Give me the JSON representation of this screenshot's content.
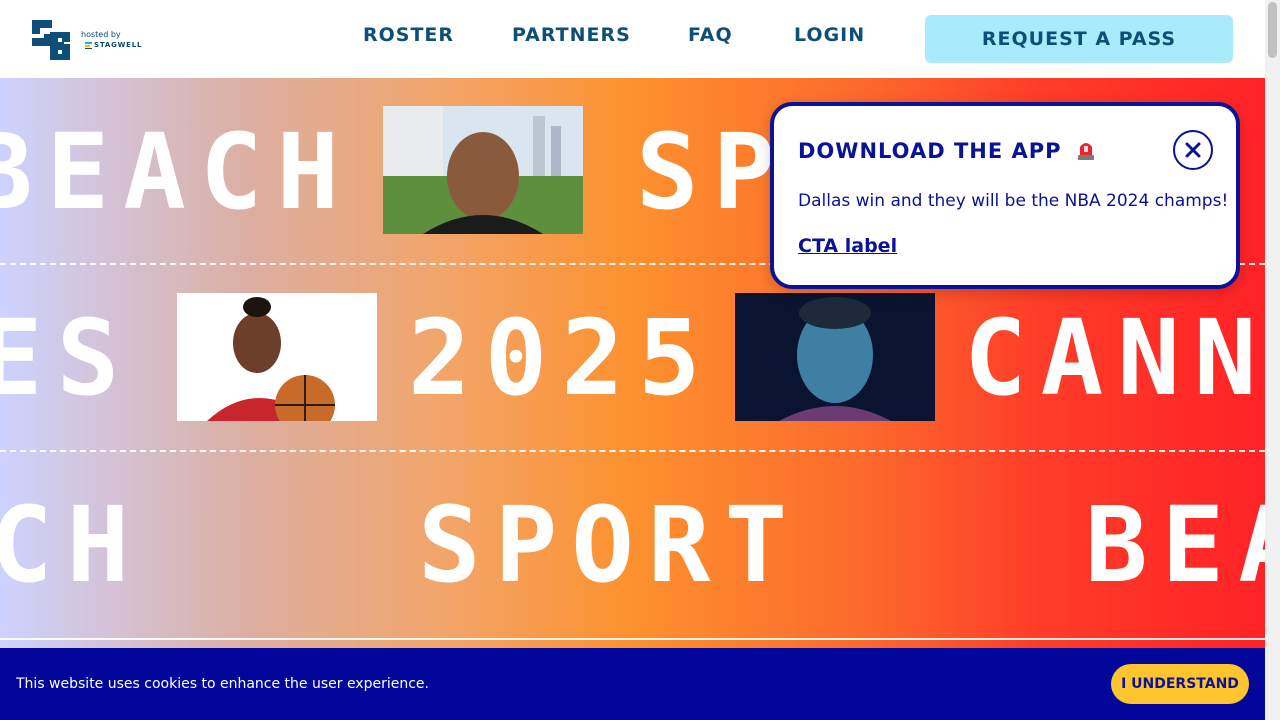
{
  "brand": {
    "logo_text": "SB",
    "hosted_by": "hosted by",
    "host_name": "STAGWELL"
  },
  "nav": {
    "items": [
      {
        "label": "ROSTER"
      },
      {
        "label": "PARTNERS"
      },
      {
        "label": "FAQ"
      },
      {
        "label": "LOGIN"
      }
    ],
    "cta_label": "REQUEST A PASS"
  },
  "hero": {
    "row1": {
      "left_word": "BEACH",
      "right_word": "SP"
    },
    "row2": {
      "left_word": "ES",
      "middle_word": "2025",
      "right_word": "CANN"
    },
    "row3": {
      "left_word": "CH",
      "middle_word": "SPORT",
      "right_word": "BEA"
    }
  },
  "popup": {
    "title": "DOWNLOAD THE APP",
    "icon": "siren-icon",
    "body": "Dallas win and they will be the NBA 2024 champs!",
    "link_label": "CTA label",
    "close_icon": "close-icon"
  },
  "cookie_banner": {
    "message": "This website uses cookies to enhance the user experience.",
    "button_label": "I UNDERSTAND"
  },
  "colors": {
    "nav_text": "#0d4f79",
    "cta_bg": "#a8ecfc",
    "popup_accent": "#0a1296",
    "cookie_bg": "#02069a",
    "cookie_btn": "#ffc52e"
  }
}
